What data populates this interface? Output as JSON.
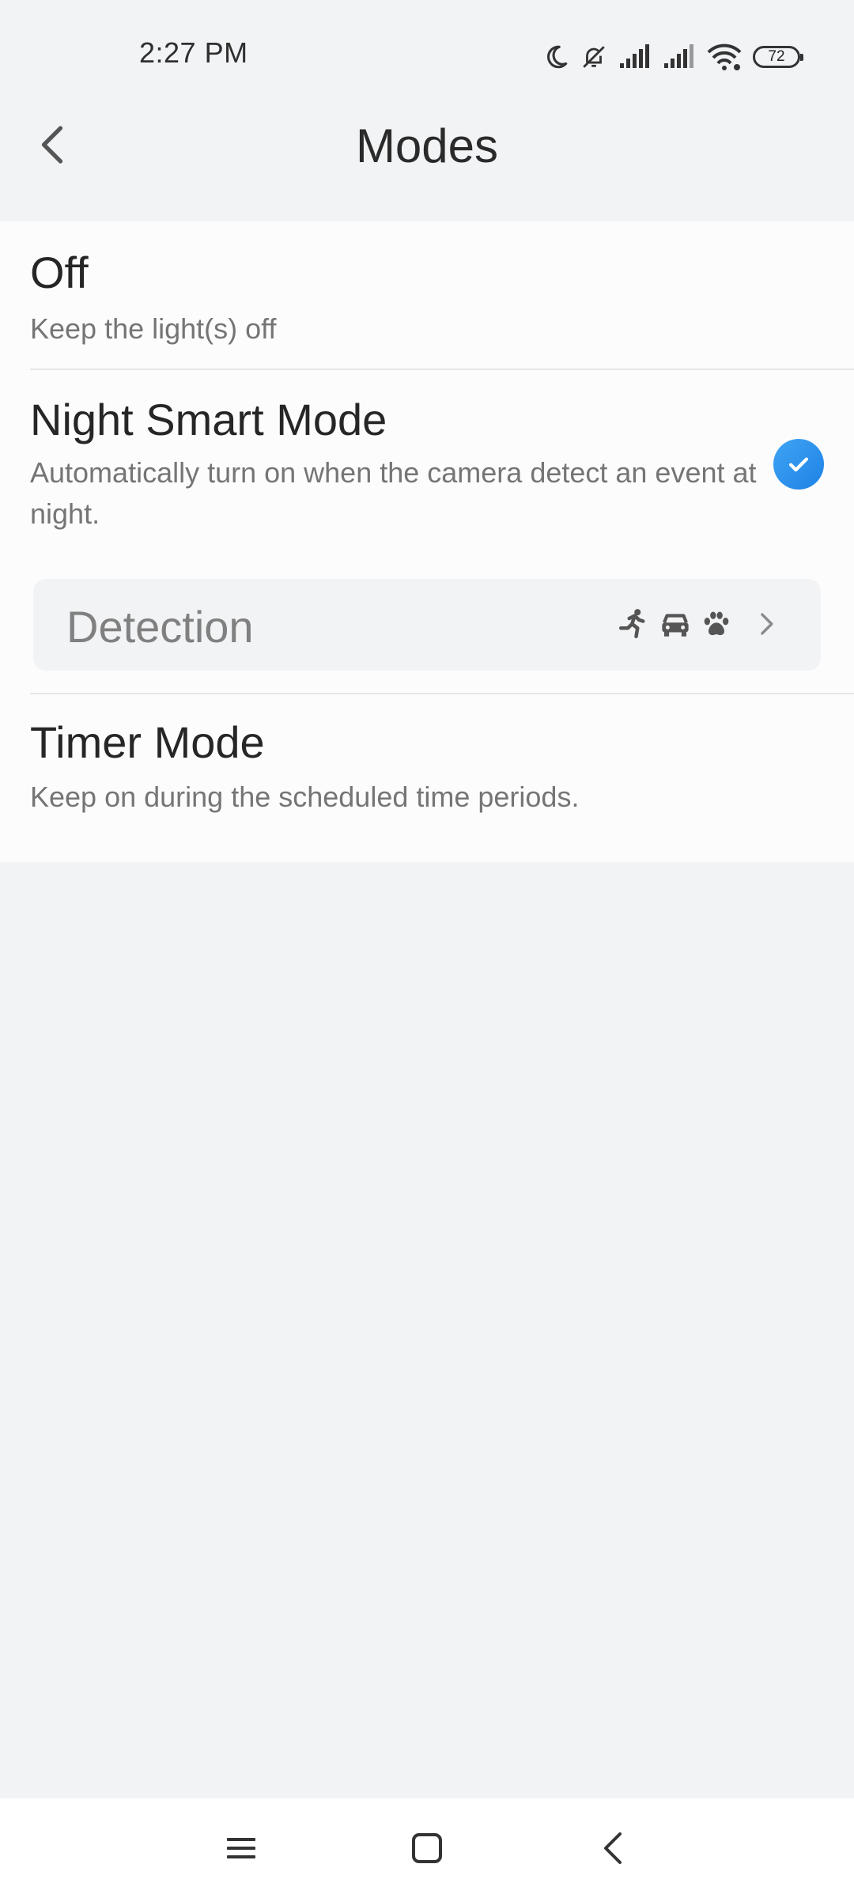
{
  "status_bar": {
    "time": "2:27 PM",
    "battery_level": "72",
    "icons": [
      "moon-icon",
      "bell-off-icon",
      "signal-icon",
      "signal-icon",
      "wifi-icon",
      "battery-icon"
    ]
  },
  "header": {
    "title": "Modes",
    "back_icon": "chevron-left-icon"
  },
  "modes": [
    {
      "title": "Off",
      "description": "Keep the light(s) off",
      "selected": false
    },
    {
      "title": "Night Smart Mode",
      "description": "Automatically turn on when the camera detect an event at night.",
      "selected": true,
      "detection": {
        "label": "Detection",
        "icons": [
          "running-person-icon",
          "car-icon",
          "paw-icon"
        ]
      }
    },
    {
      "title": "Timer Mode",
      "description": "Keep on during the scheduled time periods.",
      "selected": false
    }
  ],
  "colors": {
    "accent": "#1E82E6",
    "background": "#F2F3F5",
    "card": "#FCFCFC",
    "primary_text": "#262626",
    "secondary_text": "#757575"
  },
  "nav_bar": {
    "icons": [
      "menu-icon",
      "home-square-icon",
      "back-chevron-icon"
    ]
  }
}
